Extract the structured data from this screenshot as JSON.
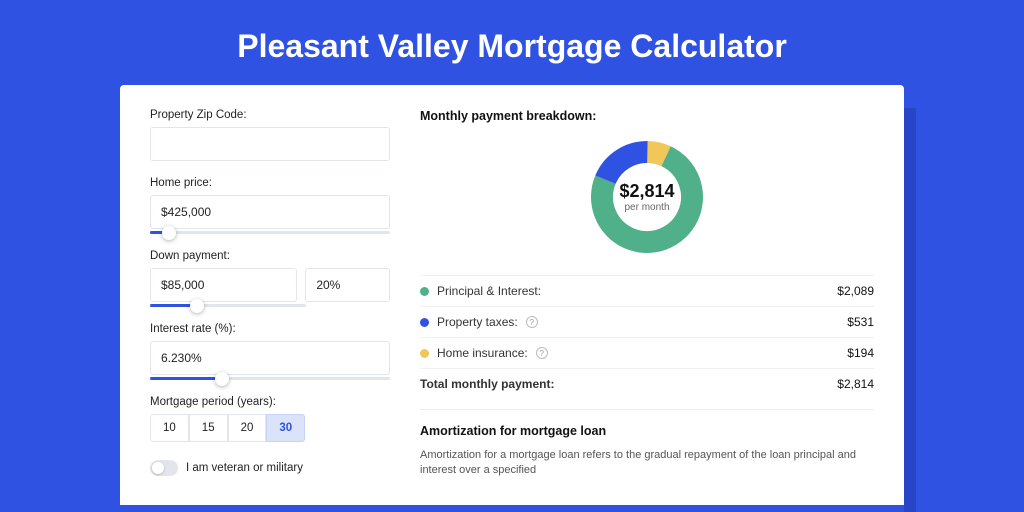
{
  "title": "Pleasant Valley Mortgage Calculator",
  "form": {
    "zip_label": "Property Zip Code:",
    "zip_value": "",
    "home_price_label": "Home price:",
    "home_price_value": "$425,000",
    "home_price_slider_pct": 8,
    "down_payment_label": "Down payment:",
    "down_payment_value": "$85,000",
    "down_payment_pct": "20%",
    "down_payment_slider_pct": 20,
    "interest_label": "Interest rate (%):",
    "interest_value": "6.230%",
    "interest_slider_pct": 30,
    "period_label": "Mortgage period (years):",
    "period_options": [
      "10",
      "15",
      "20",
      "30"
    ],
    "period_selected": "30",
    "veteran_label": "I am veteran or military"
  },
  "breakdown": {
    "title": "Monthly payment breakdown:",
    "center_amount": "$2,814",
    "center_sub": "per month",
    "items": [
      {
        "label": "Principal & Interest:",
        "value": "$2,089",
        "color": "#4fb08a",
        "info": false
      },
      {
        "label": "Property taxes:",
        "value": "$531",
        "color": "#3052e3",
        "info": true
      },
      {
        "label": "Home insurance:",
        "value": "$194",
        "color": "#f1c75a",
        "info": true
      }
    ],
    "total_label": "Total monthly payment:",
    "total_value": "$2,814"
  },
  "chart_data": {
    "type": "pie",
    "title": "Monthly payment breakdown",
    "series": [
      {
        "name": "Principal & Interest",
        "value": 2089,
        "color": "#4fb08a"
      },
      {
        "name": "Property taxes",
        "value": 531,
        "color": "#3052e3"
      },
      {
        "name": "Home insurance",
        "value": 194,
        "color": "#f1c75a"
      }
    ],
    "total": 2814
  },
  "amort": {
    "title": "Amortization for mortgage loan",
    "text": "Amortization for a mortgage loan refers to the gradual repayment of the loan principal and interest over a specified"
  }
}
